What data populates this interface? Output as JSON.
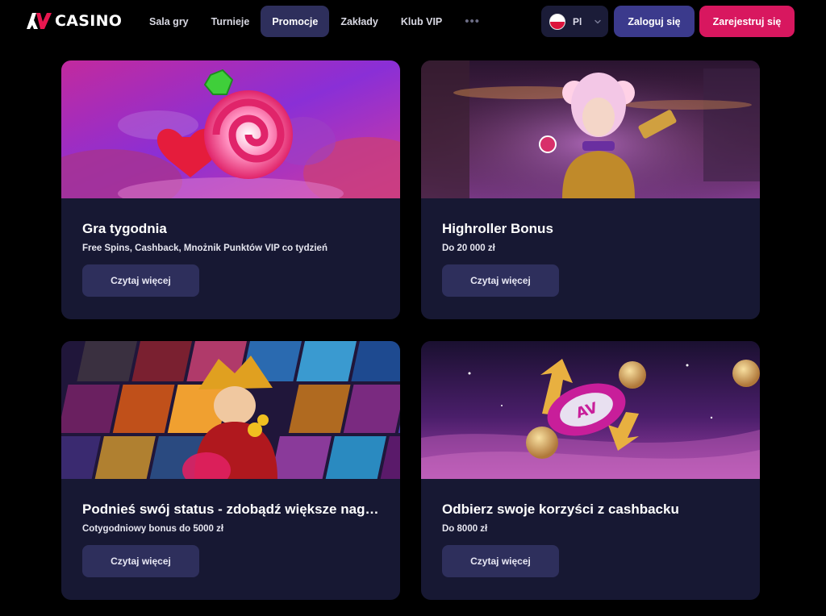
{
  "brand": {
    "logo_text": "CASINO",
    "logo_icon": "av-logo-icon"
  },
  "nav": {
    "items": [
      {
        "label": "Sala gry",
        "active": false
      },
      {
        "label": "Turnieje",
        "active": false
      },
      {
        "label": "Promocje",
        "active": true
      },
      {
        "label": "Zakłady",
        "active": false
      },
      {
        "label": "Klub VIP",
        "active": false
      }
    ],
    "more_label": "•••"
  },
  "language": {
    "code": "Pl",
    "flag_icon": "poland-flag-icon"
  },
  "auth": {
    "login_label": "Zaloguj się",
    "register_label": "Zarejestruj się"
  },
  "promotions": [
    {
      "title": "Gra tygodnia",
      "subtitle": "Free Spins, Cashback, Mnożnik Punktów VIP co tydzień",
      "button": "Czytaj więcej",
      "image_icon": "candy-lollipop-image"
    },
    {
      "title": "Highroller Bonus",
      "subtitle": "Do 20 000 zł",
      "button": "Czytaj więcej",
      "image_icon": "vip-clown-girl-image"
    },
    {
      "title": "Podnieś swój status - zdobądź większe nag…",
      "subtitle": "Cotygodniowy bonus do 5000 zł",
      "button": "Czytaj więcej",
      "image_icon": "game-collage-jester-image"
    },
    {
      "title": "Odbierz swoje korzyści z cashbacku",
      "subtitle": "Do  8000 zł",
      "button": "Czytaj więcej",
      "image_icon": "casino-chip-coins-image"
    }
  ],
  "colors": {
    "background": "#000000",
    "card_bg": "#171833",
    "button_bg": "#2e2f5c",
    "login_bg": "#3b3a8c",
    "register_bg": "#d8175f",
    "brand_red": "#e8174f"
  }
}
